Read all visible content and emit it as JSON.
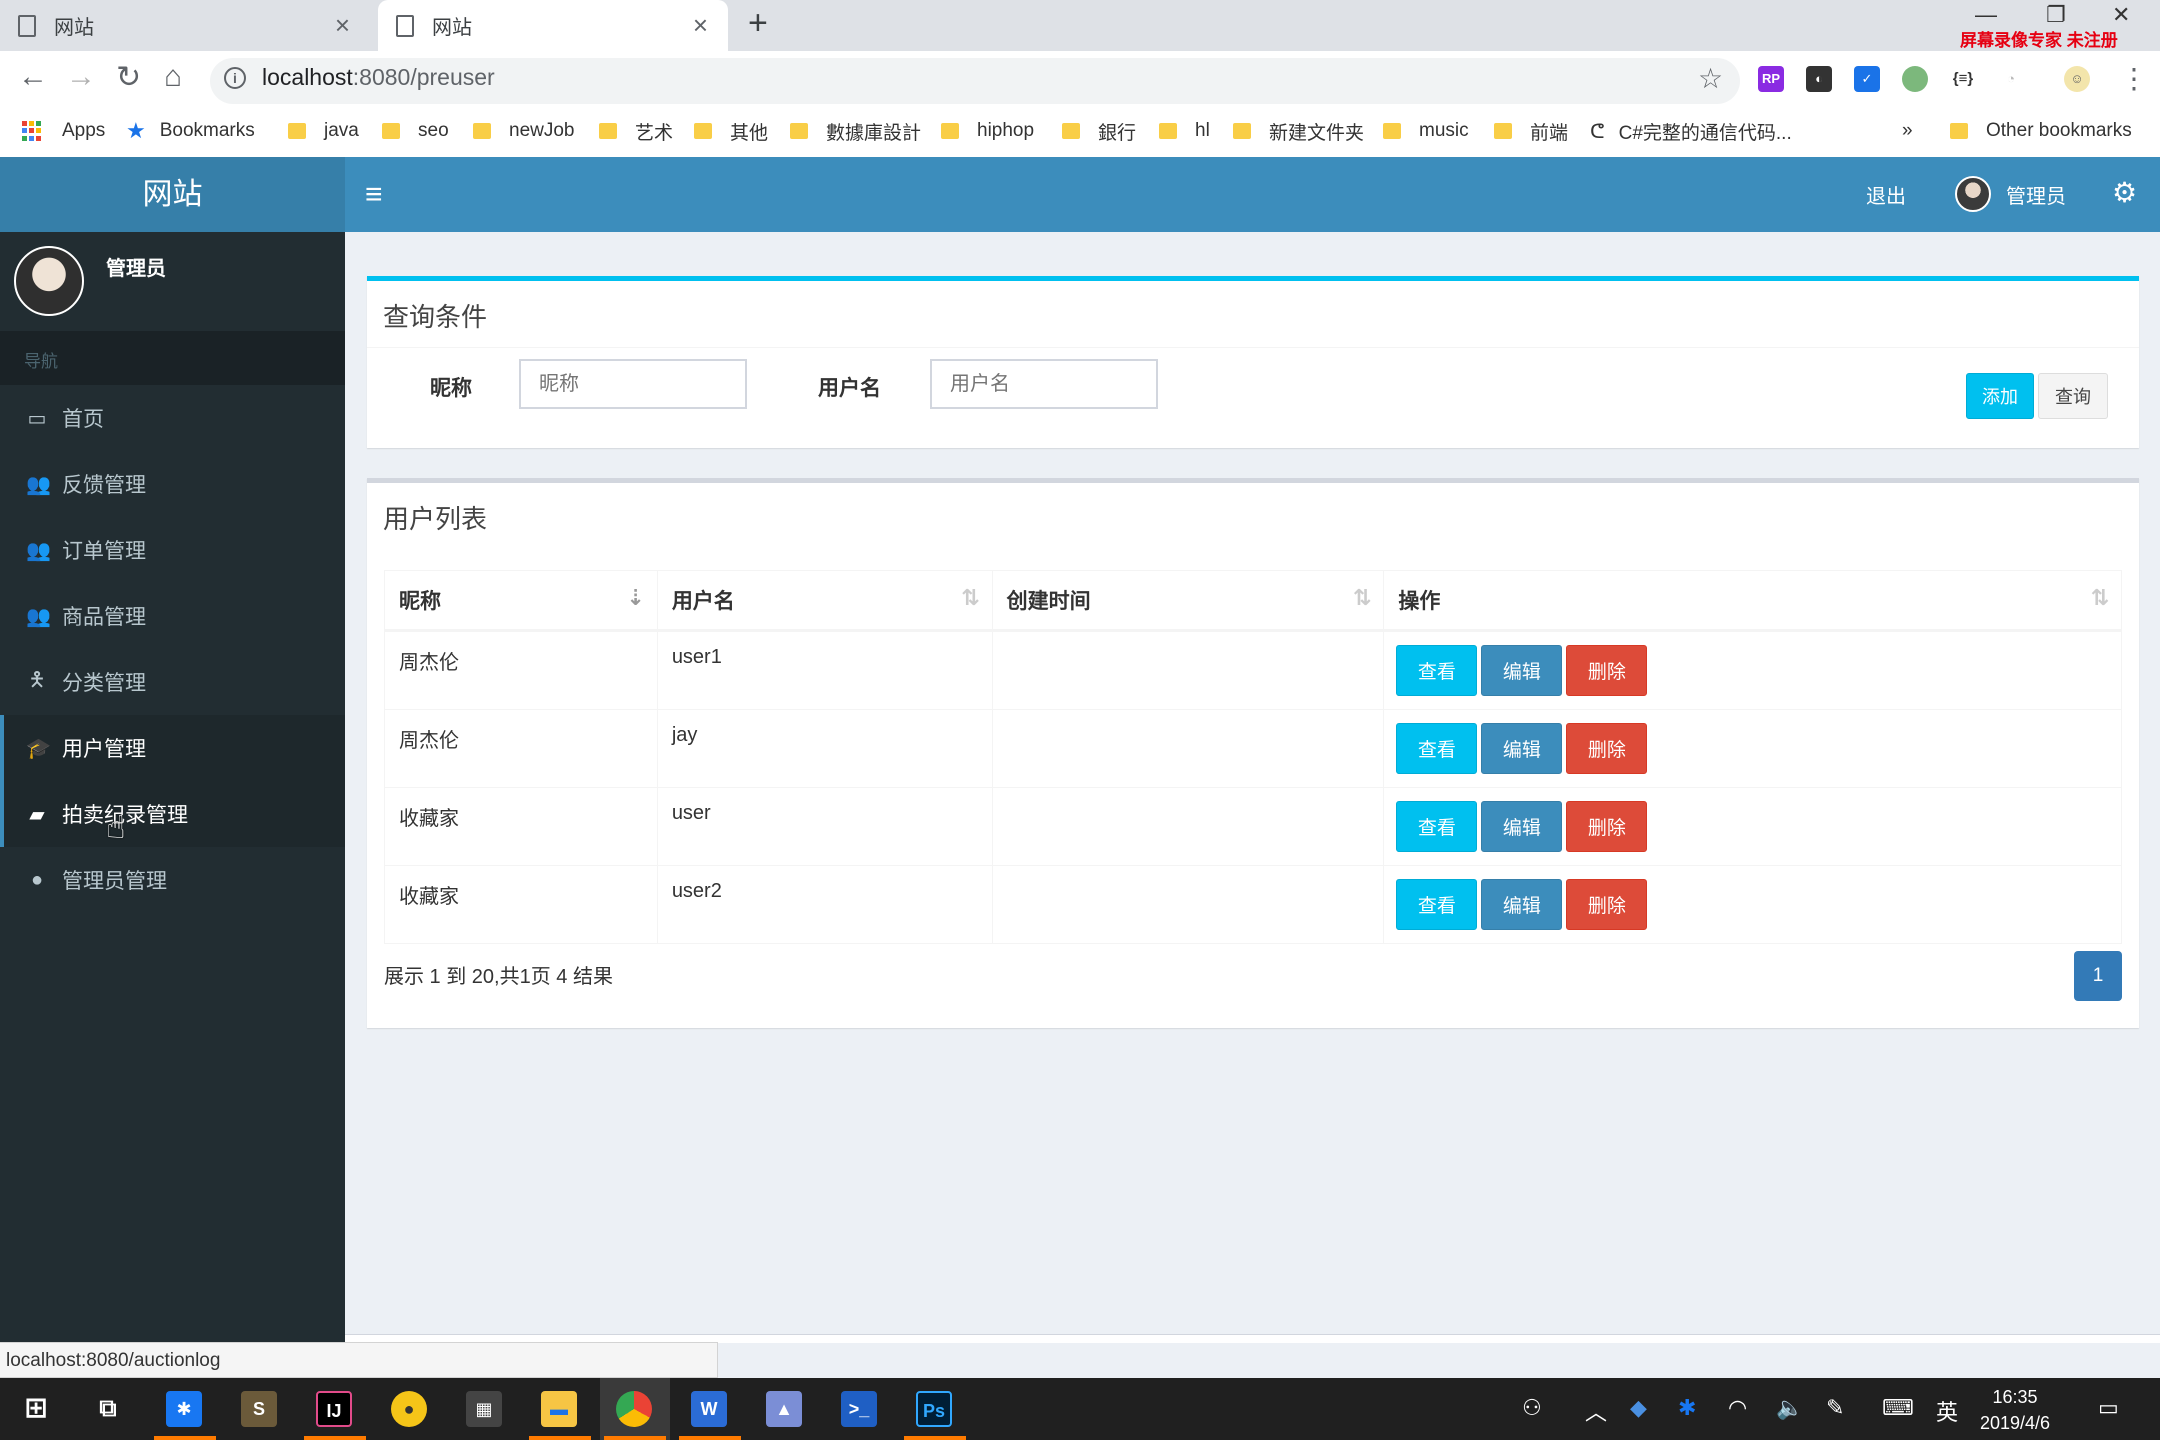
{
  "browser": {
    "tabs": [
      {
        "label": "网站",
        "active": false
      },
      {
        "label": "网站",
        "active": true
      }
    ],
    "recording_watermark": "屏幕录像专家 未注册",
    "url_host": "localhost",
    "url_path": ":8080/preuser",
    "bookmarks": [
      {
        "label": "Apps",
        "icon": "apps-grid-icon"
      },
      {
        "label": "Bookmarks",
        "icon": "star-icon"
      },
      {
        "label": "java",
        "icon": "folder-icon"
      },
      {
        "label": "seo",
        "icon": "folder-icon"
      },
      {
        "label": "newJob",
        "icon": "folder-icon"
      },
      {
        "label": "艺术",
        "icon": "folder-icon"
      },
      {
        "label": "其他",
        "icon": "folder-icon"
      },
      {
        "label": "數據庫設計",
        "icon": "folder-icon"
      },
      {
        "label": "hiphop",
        "icon": "folder-icon"
      },
      {
        "label": "銀行",
        "icon": "folder-icon"
      },
      {
        "label": "hl",
        "icon": "folder-icon"
      },
      {
        "label": "新建文件夹",
        "icon": "folder-icon"
      },
      {
        "label": "music",
        "icon": "folder-icon"
      },
      {
        "label": "前端",
        "icon": "folder-icon"
      },
      {
        "label": "C#完整的通信代码...",
        "icon": "link-icon"
      }
    ],
    "bookmarks_overflow": "»",
    "other_bookmarks": "Other bookmarks",
    "status_url": "localhost:8080/auctionlog"
  },
  "header": {
    "logo": "网站",
    "logout": "退出",
    "user_name": "管理员"
  },
  "sidebar": {
    "user_name": "管理员",
    "nav_header": "导航",
    "items": [
      {
        "label": "首页",
        "icon": "desktop-icon"
      },
      {
        "label": "反馈管理",
        "icon": "users-icon"
      },
      {
        "label": "订单管理",
        "icon": "users-icon"
      },
      {
        "label": "商品管理",
        "icon": "users-icon"
      },
      {
        "label": "分类管理",
        "icon": "child-icon"
      },
      {
        "label": "用户管理",
        "icon": "graduation-cap-icon",
        "active": true
      },
      {
        "label": "拍卖纪录管理",
        "icon": "book-icon",
        "hover": true
      },
      {
        "label": "管理员管理",
        "icon": "user-icon"
      }
    ]
  },
  "query": {
    "title": "查询条件",
    "nickname_label": "昵称",
    "nickname_placeholder": "昵称",
    "username_label": "用户名",
    "username_placeholder": "用户名",
    "add_button": "添加",
    "search_button": "查询"
  },
  "user_list": {
    "title": "用户列表",
    "columns": [
      "昵称",
      "用户名",
      "创建时间",
      "操作"
    ],
    "rows": [
      {
        "nickname": "周杰伦",
        "username": "user1",
        "created": ""
      },
      {
        "nickname": "周杰伦",
        "username": "jay",
        "created": ""
      },
      {
        "nickname": "收藏家",
        "username": "user",
        "created": ""
      },
      {
        "nickname": "收藏家",
        "username": "user2",
        "created": ""
      }
    ],
    "actions": {
      "view": "查看",
      "edit": "编辑",
      "delete": "删除"
    },
    "summary": "展示 1 到 20,共1页 4 结果",
    "current_page": "1"
  },
  "taskbar": {
    "ime": "英",
    "time": "16:35",
    "date": "2019/4/6"
  },
  "colors": {
    "navbar": "#3c8dbc",
    "logo_bg": "#367fa9",
    "sidebar": "#222d32",
    "info": "#00c0ef",
    "primary": "#3c8dbc",
    "danger": "#dd4b39"
  }
}
